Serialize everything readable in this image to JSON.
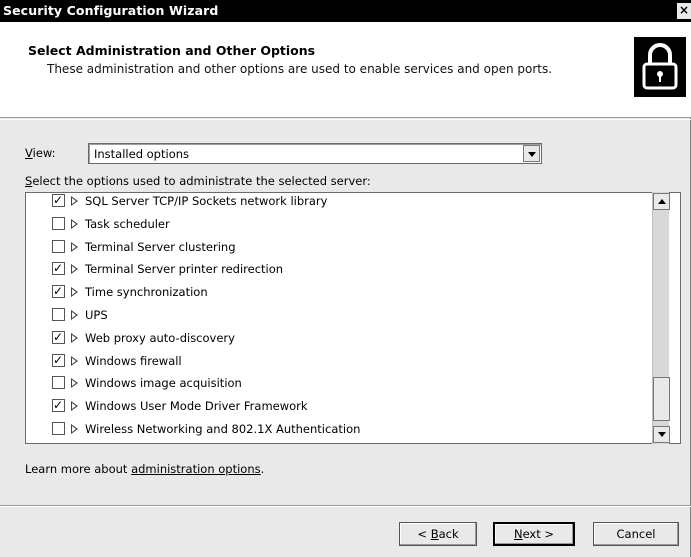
{
  "window": {
    "title": "Security Configuration Wizard",
    "close_glyph": "×"
  },
  "header": {
    "heading": "Select Administration and Other Options",
    "subheading": "These administration and other options are used to enable services and open ports."
  },
  "view": {
    "label_accel": "V",
    "label_rest": "iew:",
    "selected": "Installed options"
  },
  "select_label": {
    "accel": "S",
    "rest": "elect the options used to administrate the selected server:"
  },
  "options": [
    {
      "label": "SQL Server TCP/IP Sockets network library",
      "checked": true
    },
    {
      "label": "Task scheduler",
      "checked": false
    },
    {
      "label": "Terminal Server clustering",
      "checked": false
    },
    {
      "label": "Terminal Server printer redirection",
      "checked": true
    },
    {
      "label": "Time synchronization",
      "checked": true
    },
    {
      "label": "UPS",
      "checked": false
    },
    {
      "label": "Web proxy auto-discovery",
      "checked": true
    },
    {
      "label": "Windows firewall",
      "checked": true
    },
    {
      "label": "Windows image acquisition",
      "checked": false
    },
    {
      "label": "Windows User Mode Driver Framework",
      "checked": true
    },
    {
      "label": "Wireless Networking and 802.1X Authentication",
      "checked": false
    }
  ],
  "learn_more": {
    "prefix": "Learn more about ",
    "link": "administration options",
    "suffix": "."
  },
  "buttons": {
    "back_prefix": "< ",
    "back_accel": "B",
    "back_rest": "ack",
    "next_accel": "N",
    "next_rest": "ext >",
    "cancel": "Cancel"
  },
  "icons": {
    "header_icon": "lock-icon",
    "combo_arrow": "chevron-down-icon",
    "row_expander": "expand-triangle-icon"
  }
}
